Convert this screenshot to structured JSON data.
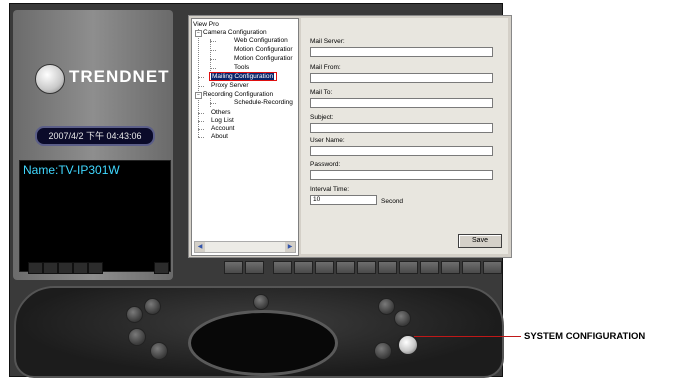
{
  "app": {
    "brand": "TRENDNET",
    "datetime": "2007/4/2 下午 04:43:06",
    "camera_name": "Name:TV-IP301W"
  },
  "tree": {
    "root": "View Pro",
    "camera_config": "Camera Configuration",
    "web_config": "Web Configuration",
    "motion_config_1": "Motion Configuratior",
    "motion_config_2": "Motion Configuratior",
    "tools": "Tools",
    "mailing_config": "Mailing Configuration",
    "proxy_server": "Proxy Server",
    "recording_config": "Recording Configuration",
    "schedule_recording": "Schedule-Recording",
    "others": "Others",
    "log_list": "Log List",
    "account": "Account",
    "about": "About"
  },
  "form": {
    "mail_server_label": "Mail Server:",
    "mail_from_label": "Mail From:",
    "mail_to_label": "Mail To:",
    "subject_label": "Subject:",
    "user_name_label": "User Name:",
    "password_label": "Password:",
    "interval_label": "Interval Time:",
    "interval_value": "10",
    "interval_unit": "Second",
    "save_label": "Save"
  },
  "callout": {
    "label": "SYSTEM CONFIGURATION",
    "color": "#c01818"
  }
}
